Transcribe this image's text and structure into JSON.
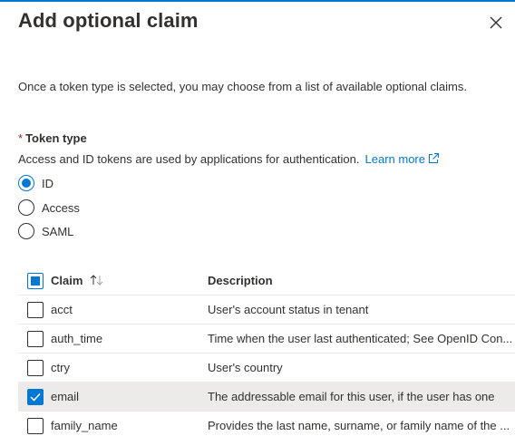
{
  "panel": {
    "title": "Add optional claim",
    "intro": "Once a token type is selected, you may choose from a list of available optional claims."
  },
  "token_type": {
    "required_marker": "*",
    "label": "Token type",
    "help_text": "Access and ID tokens are used by applications for authentication.",
    "learn_more": "Learn more",
    "options": [
      {
        "label": "ID",
        "selected": true
      },
      {
        "label": "Access",
        "selected": false
      },
      {
        "label": "SAML",
        "selected": false
      }
    ]
  },
  "claims_table": {
    "headers": {
      "claim": "Claim",
      "description": "Description"
    },
    "select_all_state": "partial",
    "rows": [
      {
        "claim": "acct",
        "description": "User's account status in tenant",
        "checked": false
      },
      {
        "claim": "auth_time",
        "description": "Time when the user last authenticated; See OpenID Con...",
        "checked": false
      },
      {
        "claim": "ctry",
        "description": "User's country",
        "checked": false
      },
      {
        "claim": "email",
        "description": "The addressable email for this user, if the user has one",
        "checked": true
      },
      {
        "claim": "family_name",
        "description": "Provides the last name, surname, or family name of the ...",
        "checked": false
      }
    ]
  },
  "colors": {
    "accent": "#0078d4",
    "required": "#a4262c",
    "selected_row": "#edebe9"
  },
  "icons": {
    "close": "close-icon",
    "external_link": "external-link-icon",
    "sort": "sort-icon",
    "checkmark": "checkmark-icon"
  }
}
